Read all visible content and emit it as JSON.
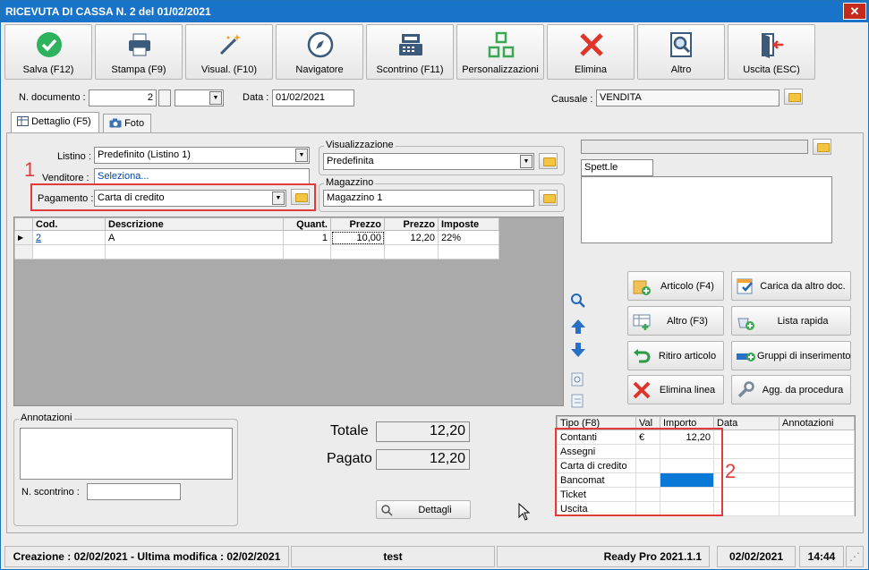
{
  "window": {
    "title": "RICEVUTA DI CASSA N. 2 del 01/02/2021",
    "close_glyph": "✕"
  },
  "toolbar": [
    {
      "label": "Salva (F12)",
      "icon": "check-circle-icon"
    },
    {
      "label": "Stampa (F9)",
      "icon": "printer-icon"
    },
    {
      "label": "Visual. (F10)",
      "icon": "magic-wand-icon"
    },
    {
      "label": "Navigatore",
      "icon": "compass-icon"
    },
    {
      "label": "Scontrino (F11)",
      "icon": "cash-register-icon"
    },
    {
      "label": "Personalizzazioni",
      "icon": "grid-squares-icon"
    },
    {
      "label": "Elimina",
      "icon": "red-x-icon"
    },
    {
      "label": "Altro",
      "icon": "magnifier-document-icon"
    },
    {
      "label": "Uscita (ESC)",
      "icon": "exit-door-icon"
    }
  ],
  "header": {
    "doc_number_label": "N. documento :",
    "doc_number": "2",
    "date_label": "Data :",
    "date": "01/02/2021",
    "causale_label": "Causale :",
    "causale": "VENDITA"
  },
  "tabs": [
    {
      "label": "Dettaglio (F5)",
      "icon": "table-icon",
      "active": true
    },
    {
      "label": "Foto",
      "icon": "camera-icon",
      "active": false
    }
  ],
  "form": {
    "listino_label": "Listino :",
    "listino": "Predefinito (Listino 1)",
    "venditore_label": "Venditore :",
    "venditore": "Seleziona...",
    "pagamento_label": "Pagamento :",
    "pagamento": "Carta di credito",
    "visualizzazione_title": "Visualizzazione",
    "visualizzazione": "Predefinita",
    "magazzino_title": "Magazzino",
    "magazzino": "Magazzino 1",
    "customer_name": "Spett.le"
  },
  "items_grid": {
    "columns": [
      "Cod.",
      "Descrizione",
      "Quant.",
      "Prezzo",
      "Prezzo",
      "Imposte"
    ],
    "rows": [
      {
        "cod": "2",
        "descrizione": "A",
        "quant": "1",
        "prezzo": "10,00",
        "prezzo2": "12,20",
        "imposte": "22%"
      }
    ]
  },
  "side_buttons": [
    {
      "label": "Articolo (F4)",
      "icon": "article-add-icon"
    },
    {
      "label": "Carica da altro doc.",
      "icon": "load-document-icon"
    },
    {
      "label": "Altro (F3)",
      "icon": "table-add-icon"
    },
    {
      "label": "Lista rapida",
      "icon": "quick-list-icon"
    },
    {
      "label": "Ritiro articolo",
      "icon": "return-arrow-icon"
    },
    {
      "label": "Gruppi di inserimento",
      "icon": "group-insert-icon"
    },
    {
      "label": "Elimina linea",
      "icon": "red-x-icon"
    },
    {
      "label": "Agg. da procedura",
      "icon": "wrench-icon"
    }
  ],
  "annotazioni": {
    "title": "Annotazioni",
    "scontrino_label": "N. scontrino :"
  },
  "totals": {
    "totale_label": "Totale",
    "totale": "12,20",
    "pagato_label": "Pagato",
    "pagato": "12,20",
    "dettagli_label": "Dettagli"
  },
  "payments": {
    "columns": [
      "Tipo (F8)",
      "Val",
      "Importo",
      "Data",
      "Annotazioni"
    ],
    "rows": [
      {
        "tipo": "Contanti",
        "val": "€",
        "importo": "12,20"
      },
      {
        "tipo": "Assegni",
        "val": "",
        "importo": ""
      },
      {
        "tipo": "Carta di credito",
        "val": "",
        "importo": ""
      },
      {
        "tipo": "Bancomat",
        "val": "",
        "importo": ""
      },
      {
        "tipo": "Ticket",
        "val": "",
        "importo": ""
      },
      {
        "tipo": "Uscita",
        "val": "",
        "importo": ""
      }
    ]
  },
  "markers": {
    "one": "1",
    "two": "2"
  },
  "status": {
    "created": "Creazione : 02/02/2021 - Ultima modifica : 02/02/2021",
    "user": "test",
    "version": "Ready Pro 2021.1.1",
    "date": "02/02/2021",
    "time": "14:44"
  },
  "colors": {
    "title_bar": "#1873c9",
    "accent_red": "#e23b3b",
    "selection_blue": "#0a78d7",
    "save_green": "#2db35d"
  }
}
